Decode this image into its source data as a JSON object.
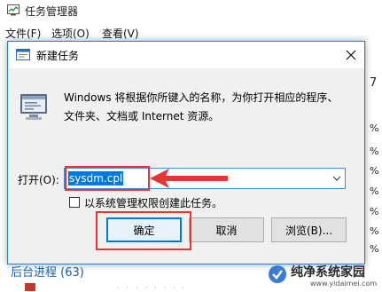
{
  "task_manager": {
    "title": "任务管理器",
    "menu": [
      "文件(F)",
      "选项(O)",
      "查看(V)"
    ],
    "right_values": [
      "7",
      "%",
      "%",
      "%",
      "%",
      "%",
      "%",
      "%",
      "%"
    ],
    "section_label": "后台进程 (63)"
  },
  "dialog": {
    "title": "新建任务",
    "description_line1": "Windows 将根据你所键入的名称，为你打开相应的程序、",
    "description_line2": "文件夹、文档或 Internet 资源。",
    "open_label": "打开(O):",
    "open_value": "sysdm.cpl",
    "admin_checkbox_label": "以系统管理权限创建此任务。",
    "admin_checked": false,
    "buttons": {
      "ok": "确定",
      "cancel": "取消",
      "browse": "浏览(B)..."
    }
  },
  "watermark": {
    "name": "纯净系统家园",
    "url": "www.yidaimei.com"
  },
  "colors": {
    "highlight_red": "#e53535",
    "selection_blue": "#0078d7",
    "dialog_bg": "#f0f0f0"
  }
}
